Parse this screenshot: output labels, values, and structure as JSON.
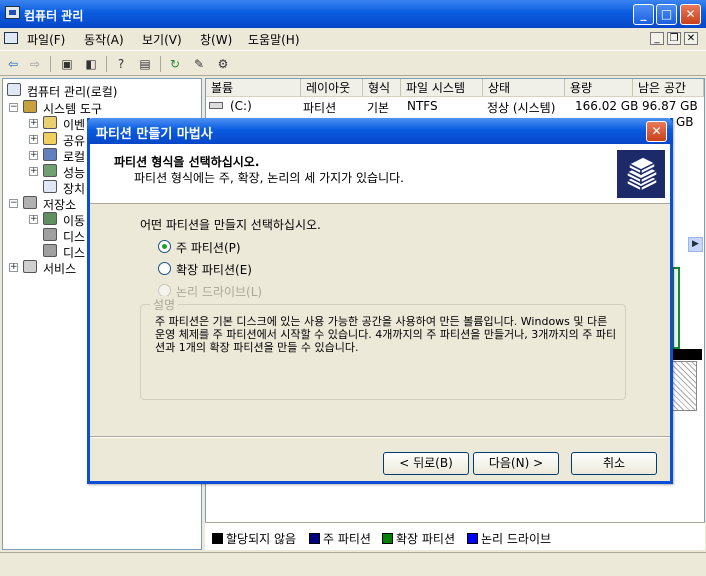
{
  "window": {
    "title": "컴퓨터 관리"
  },
  "menu": [
    "파일(F)",
    "동작(A)",
    "보기(V)",
    "창(W)",
    "도움말(H)"
  ],
  "tree": {
    "root": "컴퓨터 관리(로컬)",
    "system_tools": "시스템 도구",
    "system_children": [
      "이벤",
      "공유",
      "로컬",
      "성능",
      "장치"
    ],
    "storage": "저장소",
    "storage_children": [
      "이동",
      "디스",
      "디스"
    ],
    "services": "서비스"
  },
  "list": {
    "columns": [
      "볼륨",
      "레이아웃",
      "형식",
      "파일 시스템",
      "상태",
      "용량",
      "남은 공간"
    ],
    "rows": [
      {
        "volume": "(C:)",
        "layout": "파티션",
        "type": "기본",
        "fs": "NTFS",
        "status": "정상 (시스템)",
        "capacity": "166.02 GB",
        "free": "96.87 GB"
      }
    ],
    "row2_partial": "GB"
  },
  "legend": [
    {
      "label": "할당되지 않음",
      "color": "#000000"
    },
    {
      "label": "주 파티션",
      "color": "#000080"
    },
    {
      "label": "확장 파티션",
      "color": "#008000"
    },
    {
      "label": "논리 드라이브",
      "color": "#0000ff"
    }
  ],
  "wizard": {
    "title": "파티션 만들기 마법사",
    "header_title": "파티션 형식을 선택하십시오.",
    "header_subtitle": "파티션 형식에는 주, 확장, 논리의 세 가지가 있습니다.",
    "prompt": "어떤 파티션을 만들지 선택하십시오.",
    "options": [
      {
        "label": "주 파티션(P)",
        "checked": true,
        "enabled": true
      },
      {
        "label": "확장 파티션(E)",
        "checked": false,
        "enabled": true
      },
      {
        "label": "논리 드라이브(L)",
        "checked": false,
        "enabled": false
      }
    ],
    "desc_title": "설명",
    "description": "주 파티션은 기본 디스크에 있는 사용 가능한 공간을 사용하여 만든 볼륨입니다. Windows 및 다른 운영 체제를 주 파티션에서 시작할 수 있습니다. 4개까지의 주 파티션을 만들거나, 3개까지의 주 파티션과 1개의 확장 파티션을 만들 수 있습니다.",
    "buttons": {
      "back": "< 뒤로(B)",
      "next": "다음(N) >",
      "cancel": "취소"
    }
  }
}
